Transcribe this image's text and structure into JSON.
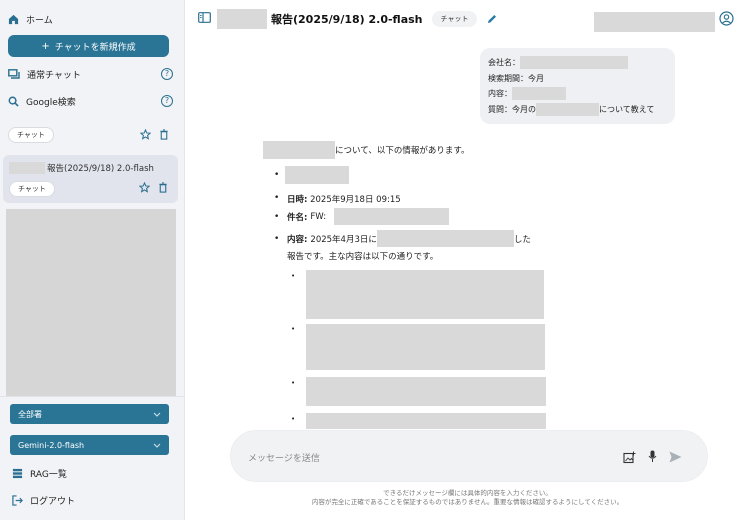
{
  "sidebar": {
    "home_label": "ホーム",
    "new_chat_label": "チャットを新規作成",
    "nav": [
      {
        "label": "通常チャット",
        "icon": "chat-icon"
      },
      {
        "label": "Google検索",
        "icon": "search-icon"
      }
    ],
    "section_tag": "チャット",
    "active_item": {
      "title": "報告(2025/9/18) 2.0-flash",
      "tag": "チャット"
    },
    "department_select": "全部署",
    "model_select": "Gemini-2.0-flash",
    "rag_label": "RAG一覧",
    "logout_label": "ログアウト"
  },
  "header": {
    "title": "報告(2025/9/18) 2.0-flash",
    "tag": "チャット"
  },
  "user_message": {
    "company_label": "会社名：",
    "period_label": "検索期間：今月",
    "content_label": "内容：",
    "question_prefix": "質問：今月の",
    "question_suffix": "について教えて"
  },
  "answer": {
    "intro_suffix": "について、以下の情報があります。",
    "date_label": "日時:",
    "date_value": "2025年9月18日 09:15",
    "subject_label": "件名:",
    "subject_value": "FW:",
    "content_label": "内容:",
    "content_prefix": "2025年4月3日に",
    "content_suffix": "した",
    "content_line2": "報告です。主な内容は以下の通りです。"
  },
  "input": {
    "placeholder": "メッセージを送信"
  },
  "disclaimer": {
    "line1": "できるだけメッセージ欄には具体的内容を入力ください。",
    "line2": "内容が完全に正確であることを保証するものではありません。重要な情報は確認するようにしてください。"
  },
  "colors": {
    "accent": "#2a7595",
    "sidebar_bg": "#f1f3f6",
    "redacted": "#d9d9d9"
  }
}
